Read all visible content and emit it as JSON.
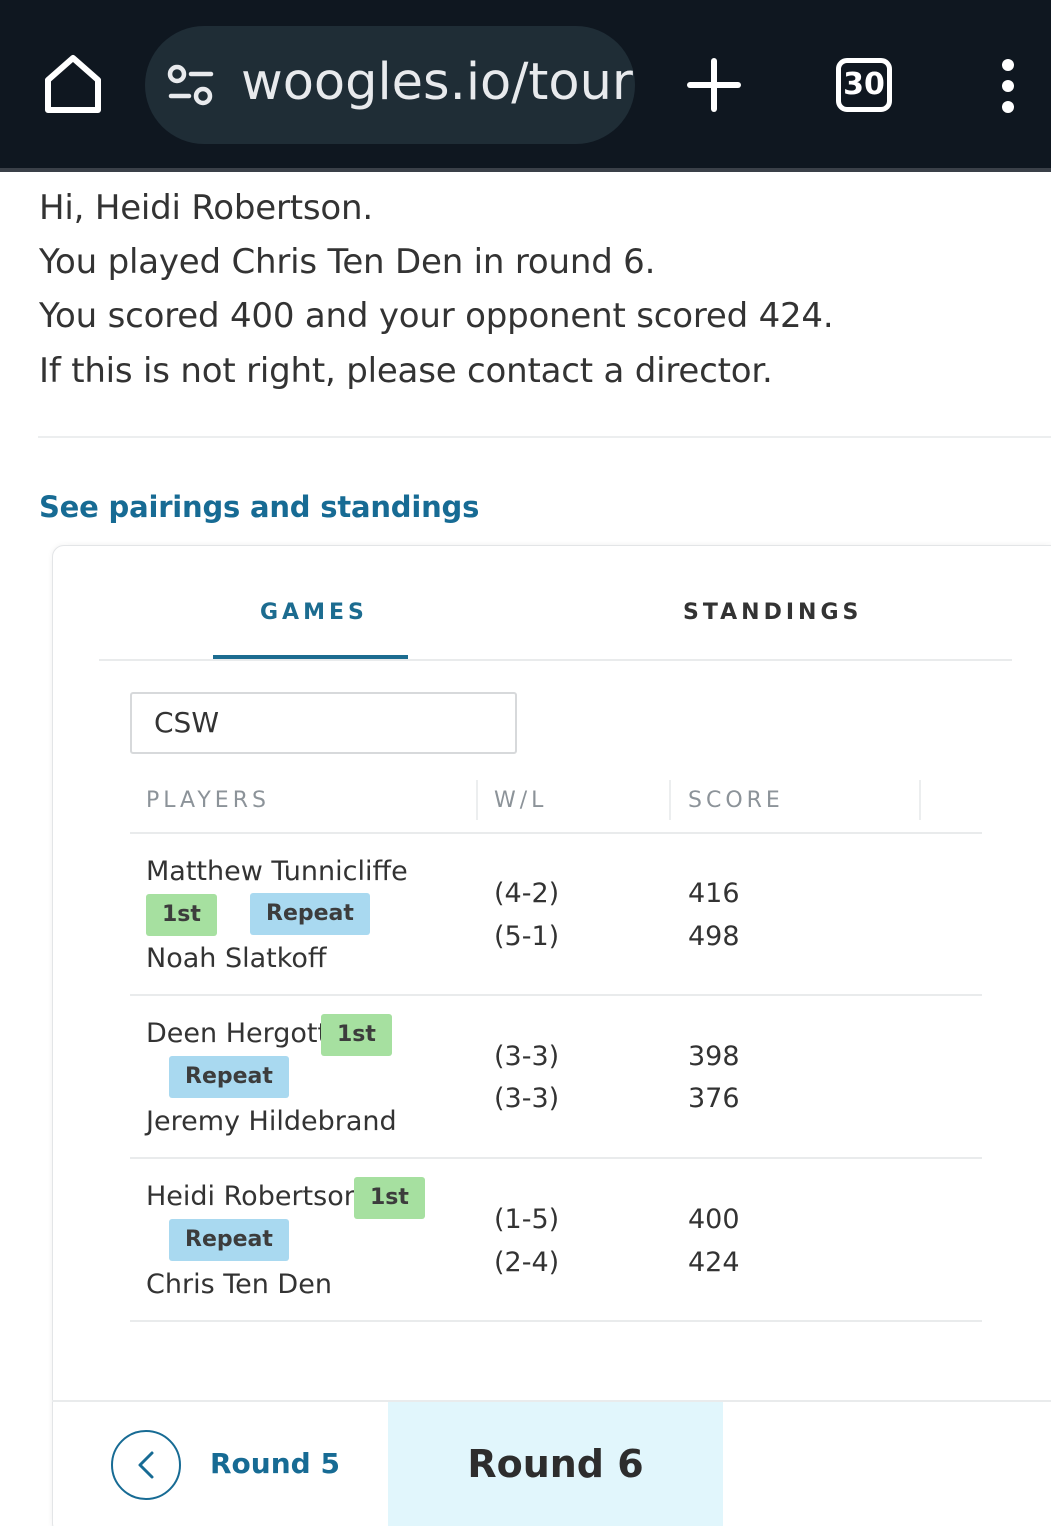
{
  "browser": {
    "url": "woogles.io/tour",
    "tab_count": "30"
  },
  "message": {
    "greeting": "Hi, Heidi Robertson.",
    "opponent_line": "You played Chris Ten Den in round 6.",
    "score_line": "You scored 400 and your opponent scored 424.",
    "contact_line": "If this is not right, please contact a director."
  },
  "see_link": "See pairings and standings",
  "tabs": {
    "games": "GAMES",
    "standings": "STANDINGS"
  },
  "division_filter": "CSW",
  "table": {
    "headers": {
      "players": "PLAYERS",
      "wl": "W/L",
      "score": "SCORE"
    },
    "rows": [
      {
        "player1": "Matthew Tunnicliffe",
        "player2": "Noah Slatkoff",
        "first_badge": "1st",
        "repeat_badge": "Repeat",
        "wl1": "(4-2)",
        "wl2": "(5-1)",
        "score1": "416",
        "score2": "498"
      },
      {
        "player1": "Deen Hergott",
        "player2": "Jeremy Hildebrand",
        "first_badge": "1st",
        "repeat_badge": "Repeat",
        "wl1": "(3-3)",
        "wl2": "(3-3)",
        "score1": "398",
        "score2": "376"
      },
      {
        "player1": "Heidi Robertson",
        "player2": "Chris Ten Den",
        "first_badge": "1st",
        "repeat_badge": "Repeat",
        "wl1": "(1-5)",
        "wl2": "(2-4)",
        "score1": "400",
        "score2": "424"
      }
    ]
  },
  "pager": {
    "prev_label": "Round 5",
    "current_label": "Round 6"
  },
  "colors": {
    "accent": "#176b94",
    "first_badge": "#a6e0a0",
    "repeat_badge": "#a9d9f0",
    "current_round_bg": "#e1f6fc",
    "topbar": "#0f1720"
  },
  "icons": {
    "home": "home-icon",
    "site_settings": "tune-icon",
    "new_tab": "plus-icon",
    "menu": "more-vert-icon",
    "prev_round": "chevron-left-icon"
  }
}
